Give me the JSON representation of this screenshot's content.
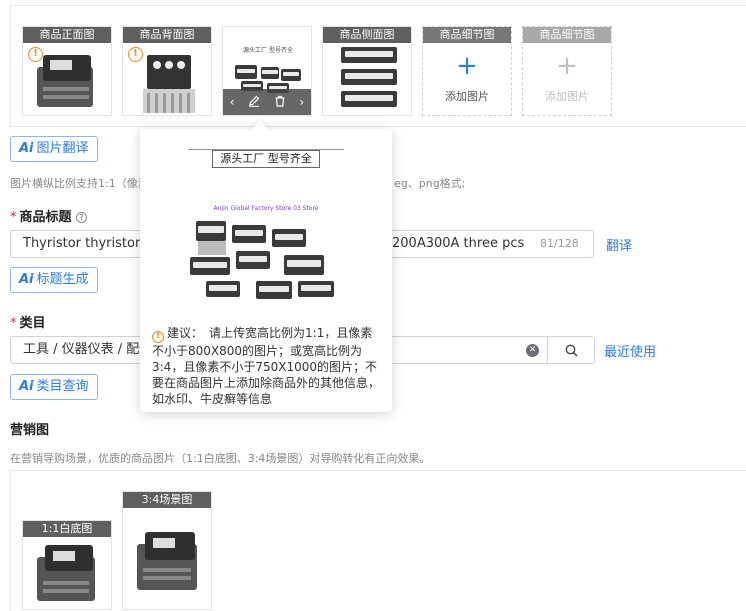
{
  "images": {
    "slots": [
      {
        "caption": "商品正面图",
        "warning": "!"
      },
      {
        "caption": "商品背面图",
        "warning": "!"
      },
      {
        "caption": "",
        "overlay_text": "源头工厂 型号齐全"
      },
      {
        "caption": "商品侧面图"
      },
      {
        "caption": "商品细节图",
        "add_label": "添加图片",
        "plus": "+"
      },
      {
        "caption": "商品细节图",
        "add_label": "添加图片",
        "plus": "+"
      }
    ],
    "translate_button": "图片翻译",
    "ratio_hint": "图片横纵比例支持1:1（像素",
    "ratio_hint_tail": "eg、png格式;"
  },
  "popover": {
    "banner": "源头工厂 型号齐全",
    "store_text": "Anjin Global Factory Store 03 Store",
    "tip_prefix": "建议：",
    "tip_text": "请上传宽高比例为1:1，且像素不小于800X800的图片；或宽高比例为3:4，且像素不小于750X1000的图片；不要在商品图片上添加除商品外的其他信息，如水印、牛皮癣等信息"
  },
  "title_field": {
    "label": "商品标题",
    "help_icon": "?",
    "value_left": "Thyristor thyristor mo",
    "value_right": "200A300A three pcs",
    "counter": "81/128",
    "translate_link": "翻译",
    "generate_button": "标题生成"
  },
  "category_field": {
    "label": "类目",
    "value": "工具 / 仪器仪表 / 配件",
    "recent_link": "最近使用",
    "query_button": "类目查询"
  },
  "marketing": {
    "label": "营销图",
    "hint": "在营销导购场景，优质的商品图片（1:1白底图、3:4场景图）对导购转化有正向效果。",
    "slots": [
      {
        "caption": "1:1白底图"
      },
      {
        "caption": "3:4场景图"
      }
    ]
  },
  "icons": {
    "warning": "warning-icon",
    "ai": "ai-icon",
    "clear": "clear-icon",
    "search": "search-icon",
    "edit": "edit-icon",
    "delete": "delete-icon"
  },
  "colors": {
    "accent": "#2a7de1",
    "warning": "#f08a24",
    "required": "#e22233"
  },
  "ai_mark": "Ai",
  "required_mark": "*",
  "nav": {
    "prev": "‹",
    "next": "›"
  }
}
